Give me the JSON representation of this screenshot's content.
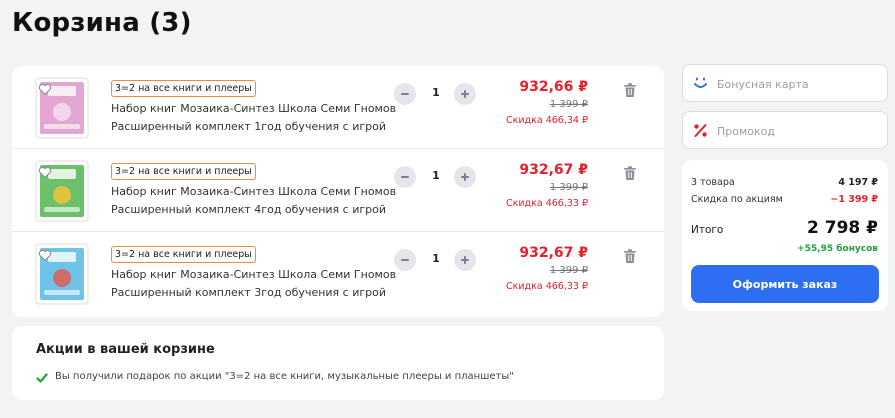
{
  "page": {
    "title": "Корзина (3)"
  },
  "colors": {
    "accent": "#2e6ef0",
    "price_red": "#e6202d",
    "bonus_green": "#1fa33b",
    "promo_border": "#f08a3a"
  },
  "cart": {
    "items": [
      {
        "promo": "3=2 на все книги и плееры",
        "name": "Набор книг Мозаика-Синтез Школа Семи Гномов Расширенный комплект 1год обучения с игрой",
        "quantity": "1",
        "price": "932,66 ₽",
        "old_price": "1 399 ₽",
        "discount": "Скидка 466,34 ₽",
        "cover_color": "#e3a5d2",
        "minus_icon": "minus-icon",
        "plus_icon": "plus-icon",
        "delete_icon": "trash-icon",
        "favorite_icon": "heart-icon"
      },
      {
        "promo": "3=2 на все книги и плееры",
        "name": "Набор книг Мозаика-Синтез Школа Семи Гномов Расширенный комплект 4год обучения с игрой",
        "quantity": "1",
        "price": "932,67 ₽",
        "old_price": "1 399 ₽",
        "discount": "Скидка 466,33 ₽",
        "cover_color": "#6cc06a",
        "minus_icon": "minus-icon",
        "plus_icon": "plus-icon",
        "delete_icon": "trash-icon",
        "favorite_icon": "heart-icon"
      },
      {
        "promo": "3=2 на все книги и плееры",
        "name": "Набор книг Мозаика-Синтез Школа Семи Гномов Расширенный комплект 3год обучения с игрой",
        "quantity": "1",
        "price": "932,67 ₽",
        "old_price": "1 399 ₽",
        "discount": "Скидка 466,33 ₽",
        "cover_color": "#6fc3e8",
        "minus_icon": "minus-icon",
        "plus_icon": "plus-icon",
        "delete_icon": "trash-icon",
        "favorite_icon": "heart-icon"
      }
    ]
  },
  "promotions": {
    "title": "Акции в вашей корзине",
    "message": "Вы получили подарок по акции \"3=2 на все книги, музыкальные плееры и планшеты\"",
    "icon": "checkmark-icon"
  },
  "sidebar": {
    "bonus_card": {
      "placeholder": "Бонусная карта",
      "value": "",
      "icon": "smile-icon"
    },
    "promo_code": {
      "placeholder": "Промокод",
      "value": "",
      "icon": "percent-icon"
    },
    "summary": {
      "items_label": "3 товара",
      "items_value": "4 197 ₽",
      "discount_label": "Скидка по акциям",
      "discount_value": "−1 399 ₽",
      "total_label": "Итого",
      "total_value": "2 798 ₽",
      "bonus": "+55,95 бонусов"
    },
    "checkout_label": "Оформить заказ"
  }
}
